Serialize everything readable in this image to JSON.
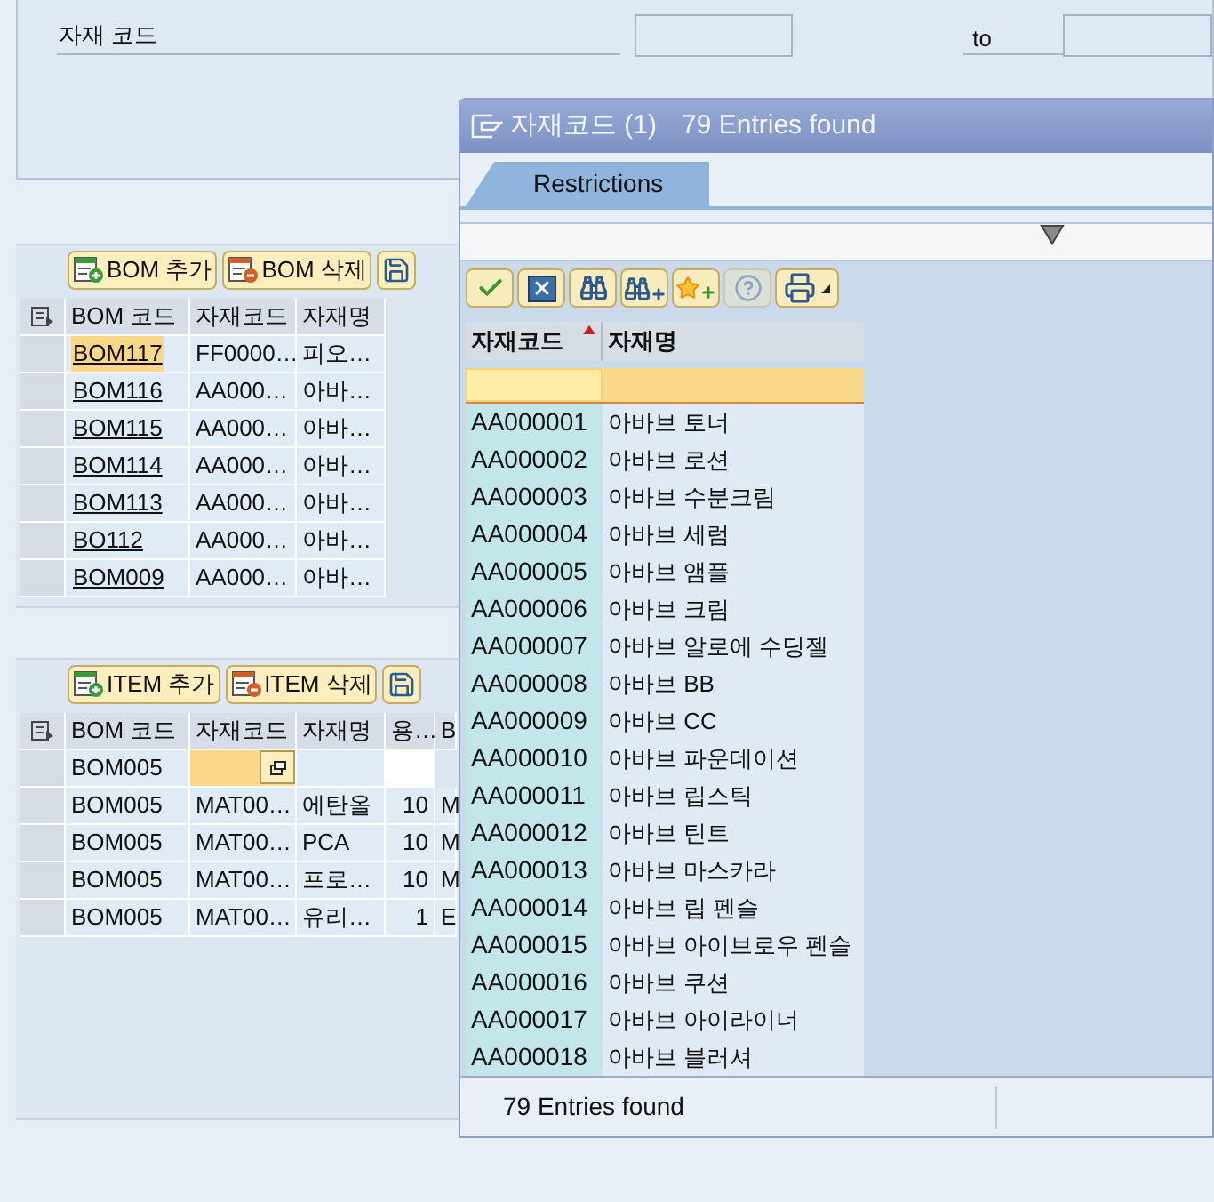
{
  "selection": {
    "label": "자재 코드",
    "to_label": "to"
  },
  "bom_toolbar": [
    {
      "kind": "add",
      "label": "BOM 추가"
    },
    {
      "kind": "delete",
      "label": "BOM 삭제"
    },
    {
      "kind": "save"
    }
  ],
  "bom_table": {
    "columns": [
      "BOM 코드",
      "자재코드",
      "자재명"
    ],
    "rows": [
      {
        "bom_code": "BOM117",
        "material_code": "FF0000…",
        "material_name": "피오…",
        "selected": true
      },
      {
        "bom_code": "BOM116",
        "material_code": "AA000…",
        "material_name": "아바…",
        "selected": false
      },
      {
        "bom_code": "BOM115",
        "material_code": "AA000…",
        "material_name": "아바…",
        "selected": false
      },
      {
        "bom_code": "BOM114",
        "material_code": "AA000…",
        "material_name": "아바…",
        "selected": false
      },
      {
        "bom_code": "BOM113",
        "material_code": "AA000…",
        "material_name": "아바…",
        "selected": false
      },
      {
        "bom_code": "BO112",
        "material_code": "AA000…",
        "material_name": "아바…",
        "selected": false
      },
      {
        "bom_code": "BOM009",
        "material_code": "AA000…",
        "material_name": "아바…",
        "selected": false
      }
    ]
  },
  "item_toolbar": [
    {
      "kind": "add",
      "label": "ITEM 추가"
    },
    {
      "kind": "delete",
      "label": "ITEM 삭제"
    },
    {
      "kind": "save"
    }
  ],
  "item_table": {
    "columns": [
      "BOM 코드",
      "자재코드",
      "자재명",
      "용…",
      "B"
    ],
    "rows": [
      {
        "kind": "input",
        "cells": [
          "BOM005"
        ]
      },
      {
        "kind": "data",
        "cells": [
          "BOM005",
          "MAT00…",
          "에탄올",
          "10",
          "M"
        ]
      },
      {
        "kind": "data",
        "cells": [
          "BOM005",
          "MAT00…",
          "PCA",
          "10",
          "M"
        ]
      },
      {
        "kind": "data",
        "cells": [
          "BOM005",
          "MAT00…",
          "프로…",
          "10",
          "M"
        ]
      },
      {
        "kind": "data",
        "cells": [
          "BOM005",
          "MAT00…",
          "유리…",
          "1",
          "E"
        ]
      }
    ]
  },
  "popup": {
    "title": "자재코드 (1)",
    "subtitle": "79 Entries found",
    "tabs": [
      {
        "label": "Restrictions",
        "selected": true
      }
    ],
    "toolbar": [
      {
        "kind": "check",
        "disabled": false
      },
      {
        "kind": "cancel",
        "disabled": false
      },
      {
        "kind": "find",
        "disabled": false
      },
      {
        "kind": "find_next",
        "disabled": false
      },
      {
        "kind": "favorite_add",
        "disabled": false
      },
      {
        "kind": "help",
        "disabled": true
      },
      {
        "kind": "print",
        "disabled": false
      }
    ],
    "columns": [
      "자재코드",
      "자재명"
    ],
    "rows": [
      {
        "code": "AA000001",
        "name": "아바브 토너"
      },
      {
        "code": "AA000002",
        "name": "아바브 로션"
      },
      {
        "code": "AA000003",
        "name": "아바브 수분크림"
      },
      {
        "code": "AA000004",
        "name": "아바브 세럼"
      },
      {
        "code": "AA000005",
        "name": "아바브 앰플"
      },
      {
        "code": "AA000006",
        "name": "아바브 크림"
      },
      {
        "code": "AA000007",
        "name": "아바브 알로에 수딩젤"
      },
      {
        "code": "AA000008",
        "name": "아바브 BB"
      },
      {
        "code": "AA000009",
        "name": "아바브 CC"
      },
      {
        "code": "AA000010",
        "name": "아바브 파운데이션"
      },
      {
        "code": "AA000011",
        "name": "아바브 립스틱"
      },
      {
        "code": "AA000012",
        "name": "아바브 틴트"
      },
      {
        "code": "AA000013",
        "name": "아바브 마스카라"
      },
      {
        "code": "AA000014",
        "name": "아바브 립 펜슬"
      },
      {
        "code": "AA000015",
        "name": "아바브 아이브로우 펜슬"
      },
      {
        "code": "AA000016",
        "name": "아바브 쿠션"
      },
      {
        "code": "AA000017",
        "name": "아바브 아이라이너"
      },
      {
        "code": "AA000018",
        "name": "아바브 블러셔"
      }
    ],
    "status": "79 Entries found"
  }
}
